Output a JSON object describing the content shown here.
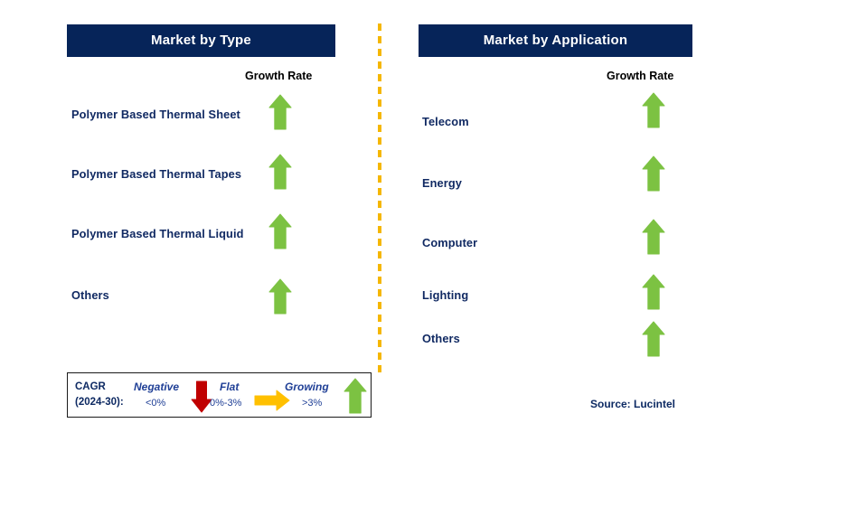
{
  "colors": {
    "header_bg": "#062459",
    "header_text": "#ffffff",
    "label_navy": "#112a63",
    "growth_arrow_green": "#7cc242",
    "negative_arrow_red": "#c00000",
    "flat_arrow_orange": "#ffc000",
    "divider_dashed": "#f5b700",
    "legend_border": "#1a1a1a",
    "legend_text_blue": "#1f3f96",
    "page_background": "#ffffff"
  },
  "panels": [
    {
      "id": "market-by-type",
      "title": "Market by Type",
      "growth_rate_header": "Growth Rate",
      "rows": [
        {
          "label": "Polymer Based Thermal Sheet",
          "growth": "growing",
          "icon": "arrow-up-green-icon"
        },
        {
          "label": "Polymer Based Thermal Tapes",
          "growth": "growing",
          "icon": "arrow-up-green-icon"
        },
        {
          "label": "Polymer Based Thermal Liquid",
          "growth": "growing",
          "icon": "arrow-up-green-icon"
        },
        {
          "label": "Others",
          "growth": "growing",
          "icon": "arrow-up-green-icon"
        }
      ]
    },
    {
      "id": "market-by-application",
      "title": "Market by Application",
      "growth_rate_header": "Growth Rate",
      "rows": [
        {
          "label": "Telecom",
          "growth": "growing",
          "icon": "arrow-up-green-icon"
        },
        {
          "label": "Energy",
          "growth": "growing",
          "icon": "arrow-up-green-icon"
        },
        {
          "label": "Computer",
          "growth": "growing",
          "icon": "arrow-up-green-icon"
        },
        {
          "label": "Lighting",
          "growth": "growing",
          "icon": "arrow-up-green-icon"
        },
        {
          "label": "Others",
          "growth": "growing",
          "icon": "arrow-up-green-icon"
        }
      ]
    }
  ],
  "legend": {
    "cagr_line1": "CAGR",
    "cagr_line2": "(2024-30):",
    "items": [
      {
        "title": "Negative",
        "range": "<0%",
        "icon": "arrow-down-red-icon"
      },
      {
        "title": "Flat",
        "range": "0%-3%",
        "icon": "arrow-right-orange-icon"
      },
      {
        "title": "Growing",
        "range": ">3%",
        "icon": "arrow-up-green-icon"
      }
    ]
  },
  "source": "Source: Lucintel"
}
